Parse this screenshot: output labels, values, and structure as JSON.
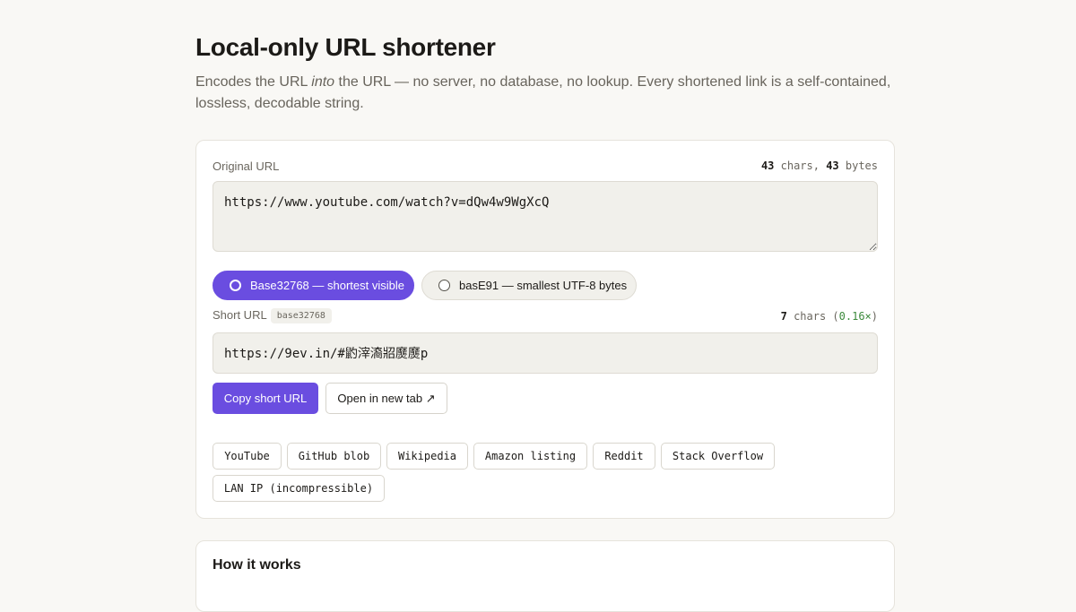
{
  "header": {
    "title": "Local-only URL shortener",
    "subtitle_pre": "Encodes the URL ",
    "subtitle_em": "into",
    "subtitle_post": " the URL — no server, no database, no lookup. Every shortened link is a self-contained, lossless, decodable string."
  },
  "original": {
    "label": "Original URL",
    "chars": "43",
    "chars_unit": " chars, ",
    "bytes": "43",
    "bytes_unit": " bytes",
    "value": "https://www.youtube.com/watch?v=dQw4w9WgXcQ"
  },
  "encodings": {
    "options": [
      {
        "label": "Base32768 — shortest visible",
        "selected": true
      },
      {
        "label": "basE91 — smallest UTF-8 bytes",
        "selected": false
      }
    ]
  },
  "short": {
    "label": "Short URL",
    "badge": "base32768",
    "chars": "7",
    "chars_unit": " chars (",
    "ratio": "0.16×",
    "ratio_close": ")",
    "value": "https://9ev.in/#䶂滓㵝㸛㸏㸏p"
  },
  "actions": {
    "copy_label": "Copy short URL",
    "open_label": "Open in new tab ↗"
  },
  "examples": [
    "YouTube",
    "GitHub blob",
    "Wikipedia",
    "Amazon listing",
    "Reddit",
    "Stack Overflow",
    "LAN IP (incompressible)"
  ],
  "how": {
    "title": "How it works"
  },
  "colors": {
    "accent": "#6a4de0",
    "background": "#f9f8f5",
    "ratio": "#3c8a3c"
  }
}
